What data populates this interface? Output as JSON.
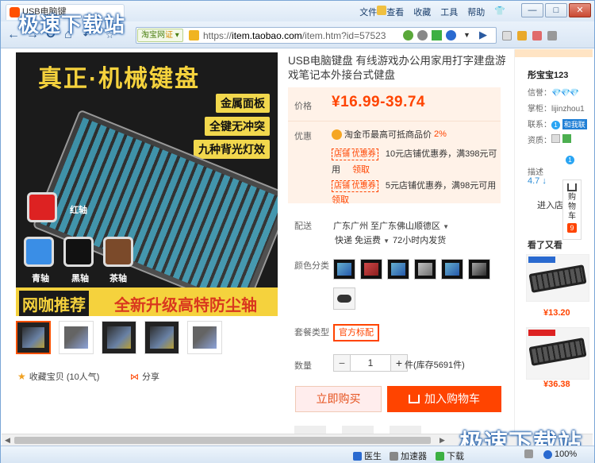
{
  "browser": {
    "tab_title": "USB电脑键",
    "watermark": "极速下载站",
    "menu": [
      "文件",
      "查看",
      "收藏",
      "工具",
      "帮助"
    ],
    "window_buttons": [
      "—",
      "□",
      "✕"
    ],
    "site_tag": "淘宝网",
    "site_tag_badge": "证",
    "url_scheme": "https://",
    "url_host": "item.taobao.com",
    "url_path": "/item.htm?id=57523"
  },
  "product": {
    "title": "USB电脑键盘 有线游戏办公用家用打字建盘游戏笔记本外接台式健盘",
    "price_label": "价格",
    "price": "¥16.99-39.74",
    "promo_label": "优惠",
    "coin_text": "淘金币最高可抵商品价",
    "coin_pct": "2%",
    "coupon_tag": "店铺 优惠券",
    "coupon1": "10元店铺优惠券，满398元可",
    "coupon1_cont": "用",
    "coupon2": "5元店铺优惠券，满98元可用",
    "get_label": "领取",
    "ship_label": "配送",
    "ship_from": "广东广州 至",
    "ship_to": "广东佛山顺德区",
    "ship_fee": "快递 免运费",
    "ship_time": "72小时内发货",
    "color_label": "颜色分类",
    "pkg_label": "套餐类型",
    "pkg_value": "官方标配",
    "qty_label": "数量",
    "qty_minus": "−",
    "qty_value": "1",
    "qty_plus": "+",
    "stock": "件(库存5691件)",
    "buy_now": "立即购买",
    "add_cart": "加入购物车",
    "collect": "收藏宝贝 (10人气)",
    "share": "分享"
  },
  "main_image": {
    "headline": "真正·机械键盘",
    "features": [
      "金属面板",
      "全键无冲突",
      "九种背光灯效"
    ],
    "switches": [
      "红轴",
      "青轴",
      "黑轴",
      "茶轴"
    ],
    "banner_left": "网咖推荐",
    "banner_right": "全新升级高特防尘轴"
  },
  "shop": {
    "name": "彤宝宝123",
    "credit_label": "信誉：",
    "keeper_label": "掌柜：",
    "keeper_value": "lijinzhou1",
    "contact_label": "联系：",
    "contact_chip": "和我联",
    "quals_label": "资质：",
    "metric_label": "描述",
    "metric_value": "4.7 ↓",
    "enter": "进入店",
    "side_cart": [
      "购",
      "物",
      "车"
    ],
    "side_cart_count": "9",
    "seen_title": "看了又看",
    "rec_prices": [
      "¥13.20",
      "¥36.38"
    ]
  },
  "status": {
    "doctor": "医生",
    "accelerator": "加速器",
    "download": "下载",
    "zoom": "100%"
  }
}
